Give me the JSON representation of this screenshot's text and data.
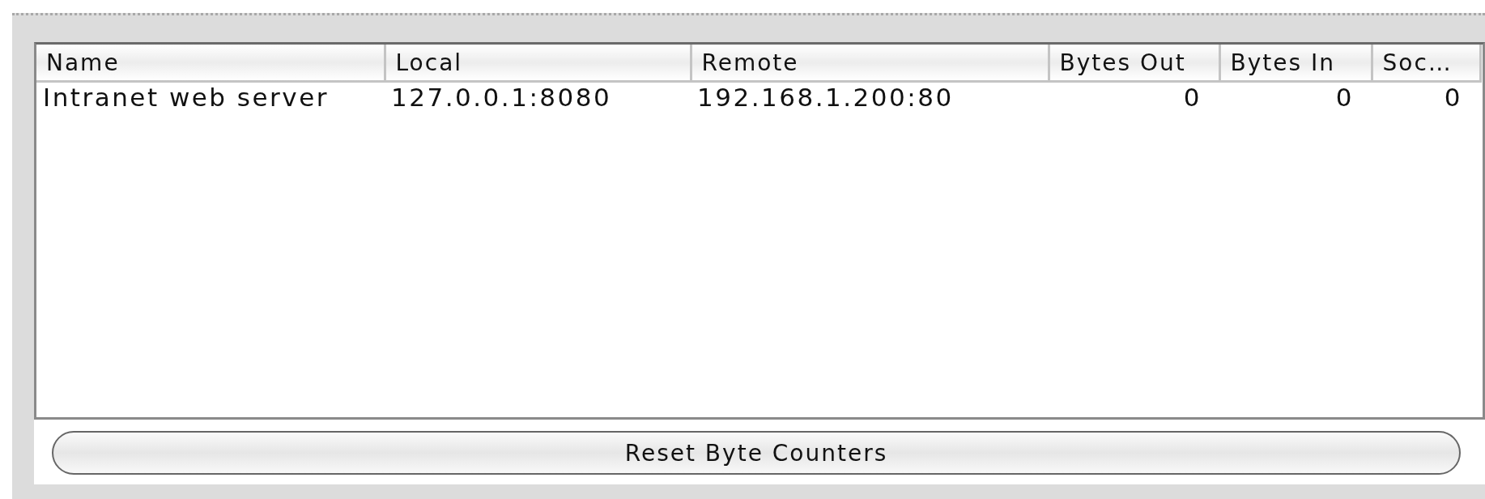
{
  "table": {
    "columns": [
      {
        "label": "Name",
        "kind": "text"
      },
      {
        "label": "Local",
        "kind": "text"
      },
      {
        "label": "Remote",
        "kind": "text"
      },
      {
        "label": "Bytes Out",
        "kind": "number"
      },
      {
        "label": "Bytes In",
        "kind": "number"
      },
      {
        "label": "Soc…",
        "kind": "number"
      }
    ],
    "rows": [
      {
        "cells": [
          "Intranet web server",
          "127.0.0.1:8080",
          "192.168.1.200:80",
          "0",
          "0",
          "0"
        ]
      }
    ]
  },
  "button": {
    "label": "Reset Byte Counters"
  }
}
